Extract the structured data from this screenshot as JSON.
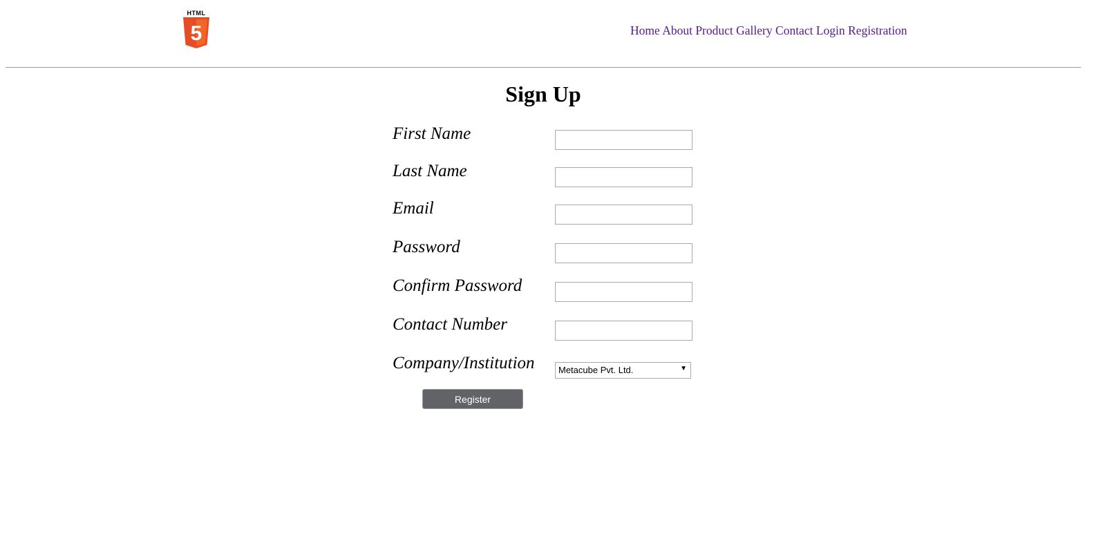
{
  "header": {
    "logo_text": "HTML",
    "logo_glyph": "5",
    "logo_color": "#e44d26",
    "nav": [
      "Home",
      "About",
      "Product",
      "Gallery",
      "Contact",
      "Login",
      "Registration"
    ],
    "nav_color": "#551a8b"
  },
  "main": {
    "title": "Sign Up",
    "fields": [
      {
        "label": "First Name",
        "value": ""
      },
      {
        "label": "Last Name",
        "value": ""
      },
      {
        "label": "Email",
        "value": ""
      },
      {
        "label": "Password",
        "value": ""
      },
      {
        "label": "Confirm Password",
        "value": ""
      },
      {
        "label": "Contact Number",
        "value": ""
      }
    ],
    "company": {
      "label": "Company/Institution",
      "selected": "Metacube Pvt. Ltd."
    },
    "register_label": "Register",
    "register_color": "#626366"
  }
}
